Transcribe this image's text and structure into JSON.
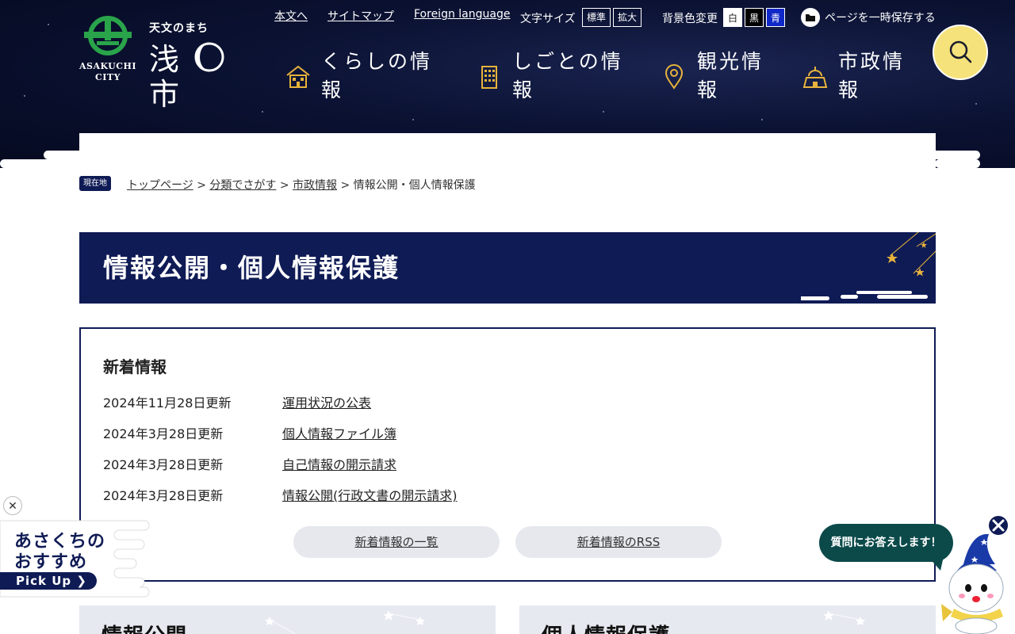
{
  "header": {
    "logo": {
      "city_en_line1": "ASAKUCHI",
      "city_en_line2": "CITY",
      "tagline": "天文のまち",
      "kanji_left": "浅",
      "kanji_right": "市"
    },
    "links": {
      "skip": "本文へ",
      "sitemap": "サイトマップ",
      "foreign": "Foreign language"
    },
    "font_size": {
      "label": "文字サイズ",
      "standard": "標準",
      "large": "拡大"
    },
    "bg_color": {
      "label": "背景色変更",
      "white": "白",
      "black": "黒",
      "blue": "青"
    },
    "save_page": "ページを一時保存する",
    "nav": [
      {
        "label": "くらしの情報",
        "icon": "house-icon"
      },
      {
        "label": "しごとの情報",
        "icon": "building-icon"
      },
      {
        "label": "観光情報",
        "icon": "map-pin-icon"
      },
      {
        "label": "市政情報",
        "icon": "city-hall-icon"
      }
    ],
    "search_icon": "search-icon"
  },
  "breadcrumb": {
    "here_label": "現在地",
    "items": [
      "トップページ",
      "分類でさがす",
      "市政情報"
    ],
    "current": "情報公開・個人情報保護",
    "sep": ">"
  },
  "page_title": "情報公開・個人情報保護",
  "news": {
    "heading": "新着情報",
    "items": [
      {
        "date": "2024年11月28日更新",
        "title": "運用状況の公表"
      },
      {
        "date": "2024年3月28日更新",
        "title": "個人情報ファイル簿"
      },
      {
        "date": "2024年3月28日更新",
        "title": "自己情報の開示請求"
      },
      {
        "date": "2024年3月28日更新",
        "title": "情報公開(行政文書の開示請求)"
      }
    ],
    "list_button": "新着情報の一覧",
    "rss_button": "新着情報のRSS"
  },
  "cards": [
    {
      "title": "情報公開"
    },
    {
      "title": "個人情報保護"
    }
  ],
  "pickup": {
    "close": "✕",
    "line1": "あさくちの",
    "line2": "おすすめ",
    "button": "Pick Up ❯"
  },
  "chat": {
    "bubble": "質問にお答えします！"
  },
  "colors": {
    "navy": "#0f1b55",
    "search_yellow": "#f5e27a",
    "chat_teal": "#0c4a4a",
    "blue_bg_button": "#1028c8"
  }
}
